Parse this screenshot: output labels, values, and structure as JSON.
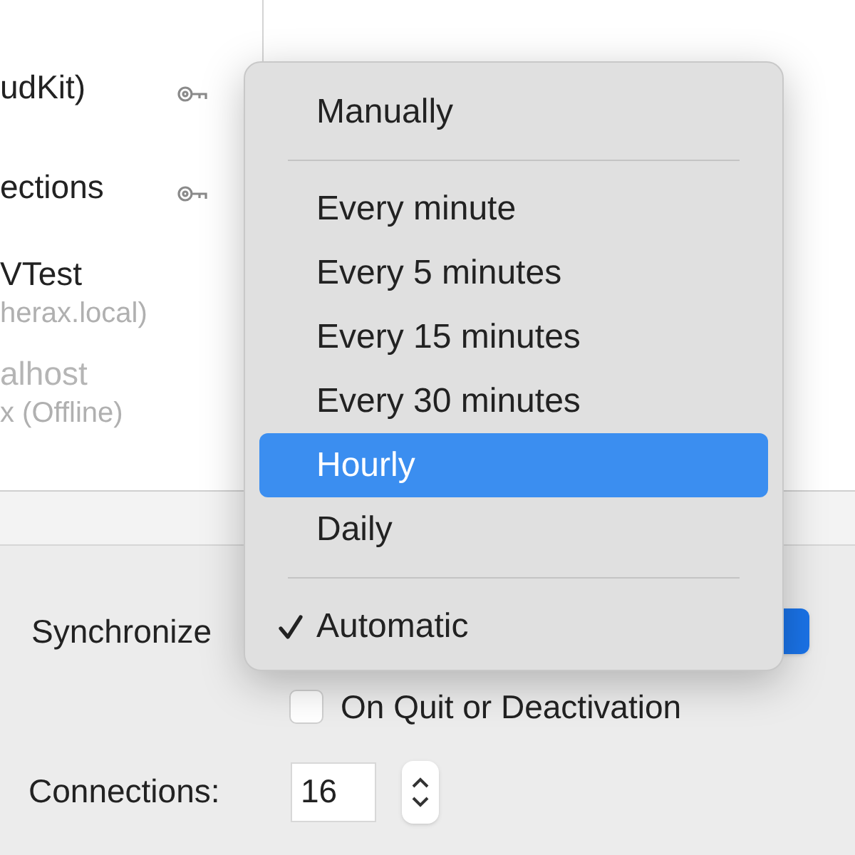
{
  "connections_list": [
    {
      "name": "udKit)",
      "key": true,
      "offline": false
    },
    {
      "name": "ections",
      "key": true,
      "offline": false
    },
    {
      "name": "VTest",
      "detail": "herax.local)",
      "key": false,
      "offline": false
    },
    {
      "name": "alhost",
      "detail": "x (Offline)",
      "key": false,
      "offline": true
    }
  ],
  "sync_menu": [
    {
      "kind": "item",
      "label": "Manually",
      "selected": false,
      "checked": false
    },
    {
      "kind": "separator"
    },
    {
      "kind": "item",
      "label": "Every minute",
      "selected": false,
      "checked": false
    },
    {
      "kind": "item",
      "label": "Every 5 minutes",
      "selected": false,
      "checked": false
    },
    {
      "kind": "item",
      "label": "Every 15 minutes",
      "selected": false,
      "checked": false
    },
    {
      "kind": "item",
      "label": "Every 30 minutes",
      "selected": false,
      "checked": false
    },
    {
      "kind": "item",
      "label": "Hourly",
      "selected": true,
      "checked": false
    },
    {
      "kind": "item",
      "label": "Daily",
      "selected": false,
      "checked": false
    },
    {
      "kind": "separator"
    },
    {
      "kind": "item",
      "label": "Automatic",
      "selected": false,
      "checked": true
    }
  ],
  "synchronize_label": "Synchronize",
  "quit_checkbox": {
    "label": "On Quit or Deactivation",
    "checked": false
  },
  "connections": {
    "label": "Connections:",
    "value": "16"
  }
}
